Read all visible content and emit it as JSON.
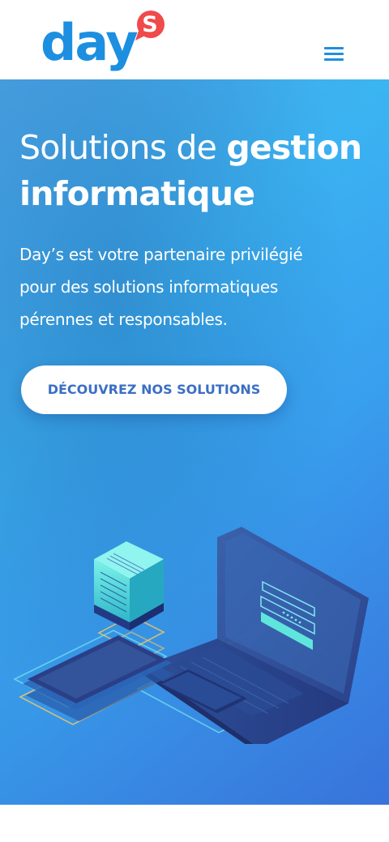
{
  "header": {
    "logo_text": "day",
    "logo_badge": "S",
    "menu_icon": "hamburger-menu-icon"
  },
  "hero": {
    "title_light": "Solutions de ",
    "title_bold_1": "gestion",
    "title_bold_2": "informatique",
    "text_line_1": "Day’s est votre partenaire privilégié",
    "text_line_2": "pour des solutions informatiques",
    "text_line_3": "pérennes et responsables.",
    "cta_label": "DÉCOUVREZ NOS SOLUTIONS",
    "illustration_icon": "isometric-laptop-server-illustration"
  },
  "colors": {
    "brand_blue": "#1d8fe1",
    "brand_red": "#f04a4a",
    "cta_text": "#3a6fc4",
    "hero_light": "#3bb4f2",
    "hero_dark": "#3c7fe8"
  }
}
